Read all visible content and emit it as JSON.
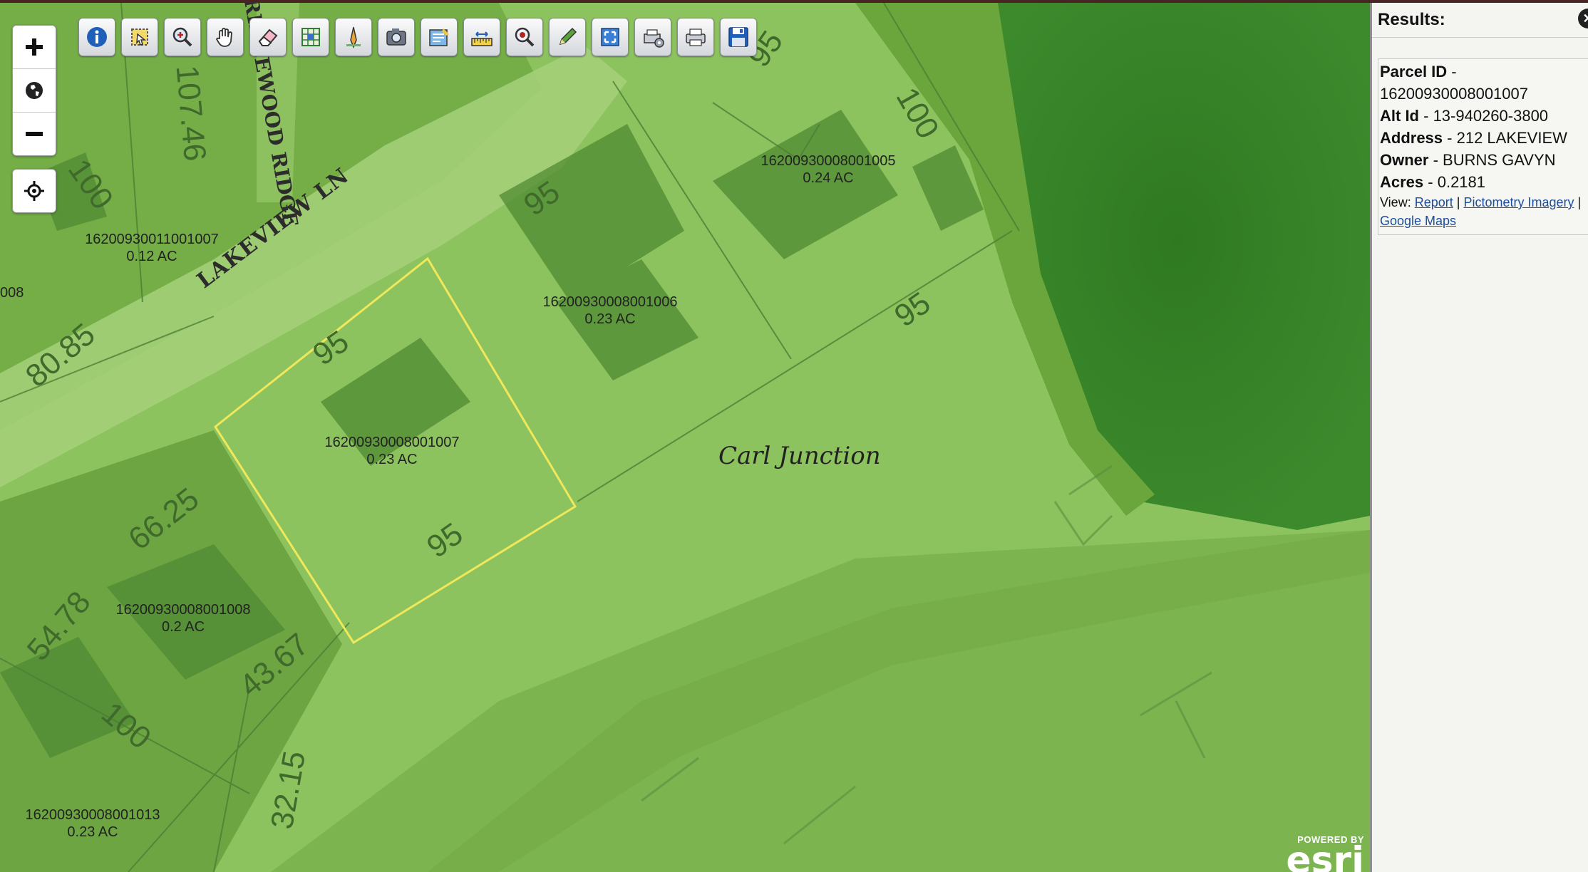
{
  "map": {
    "parcels": [
      {
        "id": "16200930008001007",
        "acres": "0.23 AC"
      },
      {
        "id": "16200930008001006",
        "acres": "0.23 AC"
      },
      {
        "id": "16200930008001005",
        "acres": "0.24 AC"
      },
      {
        "id": "16200930011001007",
        "acres": "0.12 AC"
      },
      {
        "id": "16200930008001008",
        "acres": "0.2 AC"
      },
      {
        "id": "16200930008001013",
        "acres": "0.23 AC"
      }
    ],
    "roads": {
      "lakeview": "LAKEVIEW LN",
      "ridge": "RIDGEWOOD RIDGE"
    },
    "place": "Carl Junction",
    "dimensions": [
      "95",
      "95",
      "95",
      "95",
      "95",
      "100",
      "100",
      "100",
      "107.46",
      "80.85",
      "66.25",
      "54.78",
      "43.67",
      "32.15"
    ],
    "partial_label": "008",
    "esri_powered": "POWERED BY",
    "esri_logo": "esri"
  },
  "toolbar": {
    "tools": [
      "info-icon",
      "select-icon",
      "zoom-in-tool-icon",
      "pan-icon",
      "eraser-icon",
      "grid-select-icon",
      "measure-icon",
      "camera-icon",
      "layers-icon",
      "coordinates-icon",
      "search-icon",
      "draw-icon",
      "full-extent-icon",
      "print-settings-icon",
      "print-icon",
      "save-icon"
    ]
  },
  "results": {
    "title": "Results:",
    "close_icon": "close-icon",
    "fields": [
      {
        "label": "Parcel ID",
        "value": "16200930008001007"
      },
      {
        "label": "Alt Id",
        "value": "13-940260-3800"
      },
      {
        "label": "Address",
        "value": "212 LAKEVIEW"
      },
      {
        "label": "Owner",
        "value": "BURNS GAVYN"
      },
      {
        "label": "Acres",
        "value": "0.2181"
      }
    ],
    "separator": " - ",
    "view_label": "View:",
    "links": [
      "Report",
      "Pictometry Imagery",
      "Google Maps"
    ],
    "link_sep": "|"
  }
}
